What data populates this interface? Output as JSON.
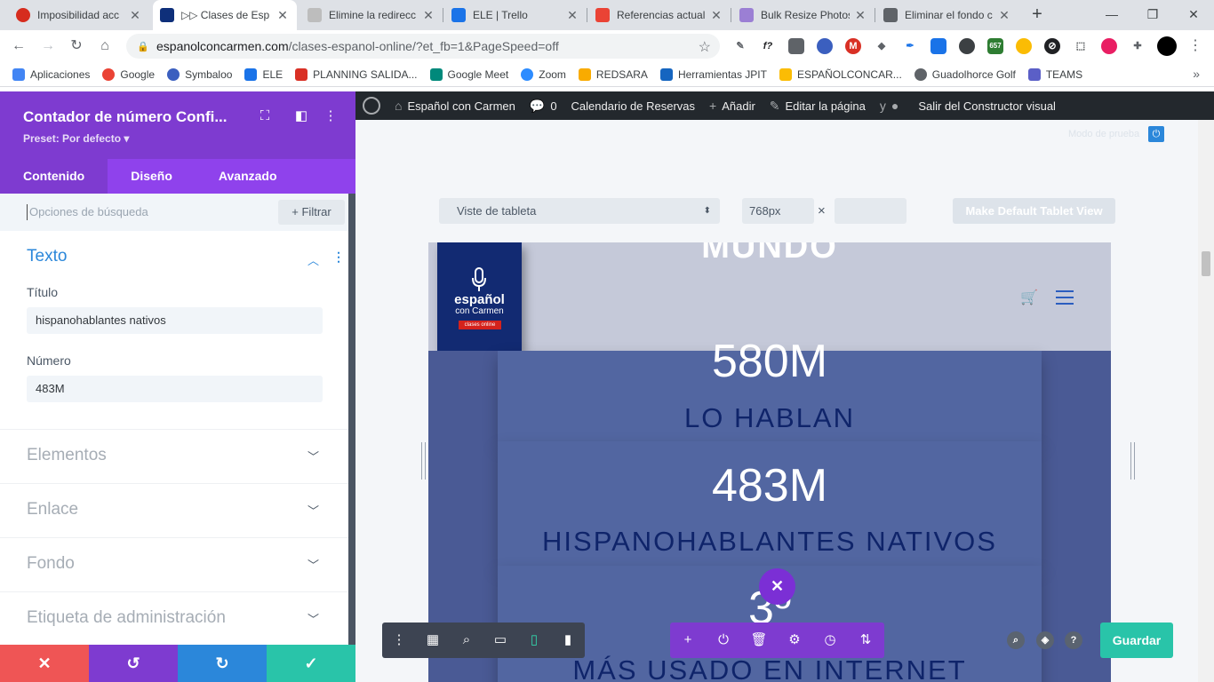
{
  "browser": {
    "tabs": [
      {
        "title": "Imposibilidad acc",
        "color": "#d62c1e"
      },
      {
        "title": "▷▷ Clases de Esp",
        "color": "#0e2f7a",
        "active": true
      },
      {
        "title": "Elimine la redirecc",
        "color": "#9aa0a6"
      },
      {
        "title": "ELE | Trello",
        "color": "#1a73e8"
      },
      {
        "title": "Referencias actual",
        "color": "#ea4335"
      },
      {
        "title": "Bulk Resize Photos",
        "color": "#9b7fd4"
      },
      {
        "title": "Eliminar el fondo c",
        "color": "#5f6368"
      }
    ],
    "new_tab": "+",
    "url_host": "espanolconcarmen.com",
    "url_path": "/clases-espanol-online/?et_fb=1&PageSpeed=off",
    "bookmarks": [
      {
        "label": "Aplicaciones",
        "color": "#4285f4"
      },
      {
        "label": "Google",
        "color": "#ea4335"
      },
      {
        "label": "Symbaloo",
        "color": "#3b5fbf"
      },
      {
        "label": "ELE",
        "color": "#1a73e8"
      },
      {
        "label": "PLANNING SALIDA...",
        "color": "#d93025"
      },
      {
        "label": "Google Meet",
        "color": "#00897b"
      },
      {
        "label": "Zoom",
        "color": "#2d8cff"
      },
      {
        "label": "REDSARA",
        "color": "#f9ab00"
      },
      {
        "label": "Herramientas JPIT",
        "color": "#1565c0"
      },
      {
        "label": "ESPAÑOLCONCAR...",
        "color": "#fbbc04"
      },
      {
        "label": "Guadolhorce Golf",
        "color": "#5f6368"
      },
      {
        "label": "TEAMS",
        "color": "#5b5fc7"
      }
    ],
    "bookmarks_more": "»"
  },
  "panel": {
    "title": "Contador de número Confi...",
    "preset": "Preset: Por defecto ▾",
    "tabs": [
      "Contenido",
      "Diseño",
      "Avanzado"
    ],
    "search_placeholder": "Opciones de búsqueda",
    "filter_label": "+ Filtrar",
    "section_open": "Texto",
    "field_title_label": "Título",
    "field_title_value": "hispanohablantes nativos",
    "field_number_label": "Número",
    "field_number_value": "483M",
    "closed_sections": [
      "Elementos",
      "Enlace",
      "Fondo",
      "Etiqueta de administración"
    ]
  },
  "wpbar": {
    "site": "Español con Carmen",
    "comments": "0",
    "calendar": "Calendario de Reservas",
    "add": "Añadir",
    "edit": "Editar la página",
    "exit": "Salir del Constructor visual"
  },
  "builder": {
    "view_select": "Viste de tableta",
    "width_value": "768px",
    "times": "×",
    "default_btn": "Make Default Tablet View",
    "top_link": "Modo de prueba",
    "save_label": "Guardar"
  },
  "preview": {
    "header_word": "MUNDO",
    "logo_line1": "español",
    "logo_line2": "con Carmen",
    "logo_line3": "clases online",
    "counters": [
      {
        "number": "580M",
        "title": "LO HABLAN"
      },
      {
        "number": "483M",
        "title": "HISPANOHABLANTES NATIVOS"
      },
      {
        "number": "3º",
        "title": "MÁS USADO EN INTERNET"
      }
    ]
  },
  "colors": {
    "divi_purple": "#7e3bd0",
    "divi_blue": "#2b87da",
    "save_green": "#29c4a9",
    "brand_navy": "#122a72"
  }
}
